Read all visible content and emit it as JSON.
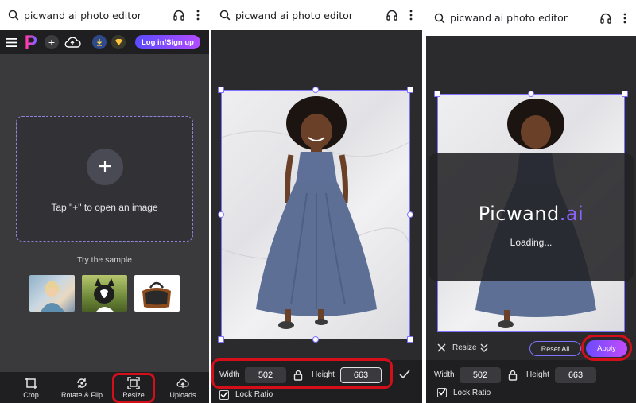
{
  "search": {
    "query": "picwand ai photo editor"
  },
  "panel1": {
    "login_label": "Log in/Sign up",
    "plus_symbol": "+",
    "dropzone_text": "Tap \"+\" to open an image",
    "try_sample_label": "Try the sample",
    "tools": [
      {
        "label": "Crop",
        "icon": "crop-icon"
      },
      {
        "label": "Rotate & Flip",
        "icon": "rotate-flip-icon"
      },
      {
        "label": "Resize",
        "icon": "resize-icon"
      },
      {
        "label": "Uploads",
        "icon": "upload-icon"
      }
    ]
  },
  "panel2": {
    "width_label": "Width",
    "width_value": "502",
    "height_label": "Height",
    "height_value": "663",
    "lock_ratio_label": "Lock Ratio"
  },
  "panel3": {
    "brand_name": "Picwand",
    "brand_suffix": ".ai",
    "loading_text": "Loading...",
    "resize_label": "Resize",
    "reset_all_label": "Reset All",
    "apply_label": "Apply",
    "width_label": "Width",
    "width_value": "502",
    "height_label": "Height",
    "height_value": "663",
    "lock_ratio_label": "Lock Ratio"
  },
  "colors": {
    "accent": "#7d73ff",
    "highlight": "#d40f1a",
    "dress": "#5d6f95"
  }
}
